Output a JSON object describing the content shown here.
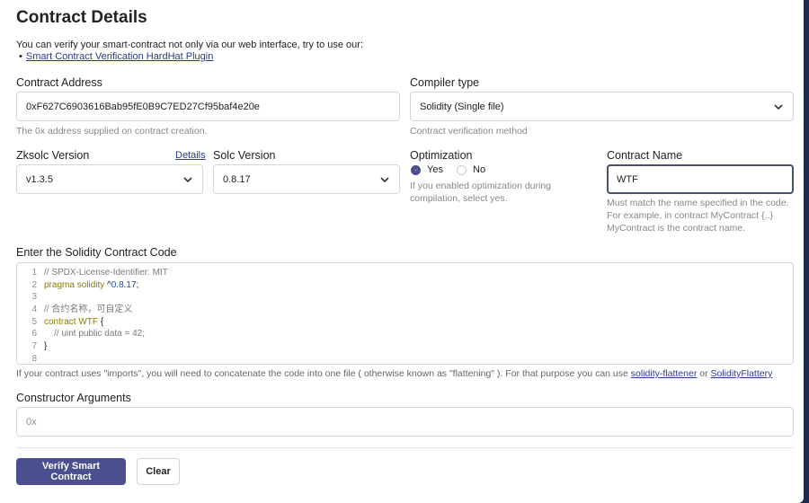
{
  "page": {
    "title": "Contract Details",
    "intro": "You can verify your smart-contract not only via our web interface, try to use our:",
    "plugin_link": "Smart Contract Verification HardHat Plugin"
  },
  "address": {
    "label": "Contract Address",
    "value": "0xF627C6903616Bab95fE0B9C7ED27Cf95baf4e20e",
    "help": "The 0x address supplied on contract creation."
  },
  "compiler": {
    "label": "Compiler type",
    "value": "Solidity (Single file)",
    "help": "Contract verification method"
  },
  "zksolc": {
    "label": "Zksolc Version",
    "details_link": "Details",
    "value": "v1.3.5"
  },
  "solc": {
    "label": "Solc Version",
    "value": "0.8.17"
  },
  "optimization": {
    "label": "Optimization",
    "yes": "Yes",
    "no": "No",
    "selected": "Yes",
    "help_1": "If you enabled optimization during",
    "help_2": "compilation, select yes."
  },
  "contract_name": {
    "label": "Contract Name",
    "value": "WTF",
    "help_1": "Must match the name specified in the code.",
    "help_2": "For example, in contract MyContract {..}",
    "help_3": "MyContract is the contract name."
  },
  "code": {
    "label": "Enter the Solidity Contract Code",
    "lines": [
      {
        "n": "1",
        "text": "// SPDX-License-Identifier: MIT"
      },
      {
        "n": "2",
        "text": "pragma solidity ^0.8.17;"
      },
      {
        "n": "3",
        "text": ""
      },
      {
        "n": "4",
        "text": "// 合约名称，可自定义"
      },
      {
        "n": "5",
        "text": "contract WTF {"
      },
      {
        "n": "6",
        "text": "    // uint public data = 42;"
      },
      {
        "n": "7",
        "text": "}"
      },
      {
        "n": "8",
        "text": ""
      }
    ]
  },
  "flatten_note": {
    "text": "If your contract uses \"imports\", you will need to concatenate the code into one file ( otherwise known as \"flattening\" ). For that purpose you can use",
    "link1": "solidity-flattener",
    "or": "or",
    "link2": "SolidityFlattery"
  },
  "constructor": {
    "label": "Constructor Arguments",
    "placeholder": "0x"
  },
  "buttons": {
    "verify": "Verify Smart Contract",
    "clear": "Clear"
  },
  "colors": {
    "primary": "#4b4f8f",
    "link": "#2b3a8c",
    "backdrop": "#1e2a4f"
  }
}
